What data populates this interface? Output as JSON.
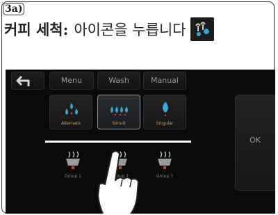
{
  "step": {
    "label": "3a)"
  },
  "instruction": {
    "bold_text": "커피 세척:",
    "normal_text": "아이콘을 누릅니다",
    "icon": "cleaning-icon"
  },
  "screen": {
    "back_icon": "back-arrow-icon",
    "tabs": [
      {
        "label": "Menu"
      },
      {
        "label": "Wash"
      },
      {
        "label": "Manual"
      }
    ],
    "tiles": [
      {
        "label": "Alternate",
        "icon": "three-drops-icon",
        "selected": false
      },
      {
        "label": "Simult",
        "icon": "four-drops-icon",
        "selected": true
      },
      {
        "label": "Singular",
        "icon": "single-drop-icon",
        "selected": false
      }
    ],
    "cups": [
      {
        "label": "Group 1",
        "icon": "cup-steam-icon"
      },
      {
        "label": "Group 2",
        "icon": "cup-steam-icon"
      },
      {
        "label": "Group 3",
        "icon": "cup-steam-icon"
      }
    ],
    "ok_label": "OK",
    "colors": {
      "accent_blue": "#3aa6d8",
      "accent_red": "#d23a2a",
      "label_tan": "#c9a070"
    }
  },
  "hand_icon": "pointing-hand-icon"
}
